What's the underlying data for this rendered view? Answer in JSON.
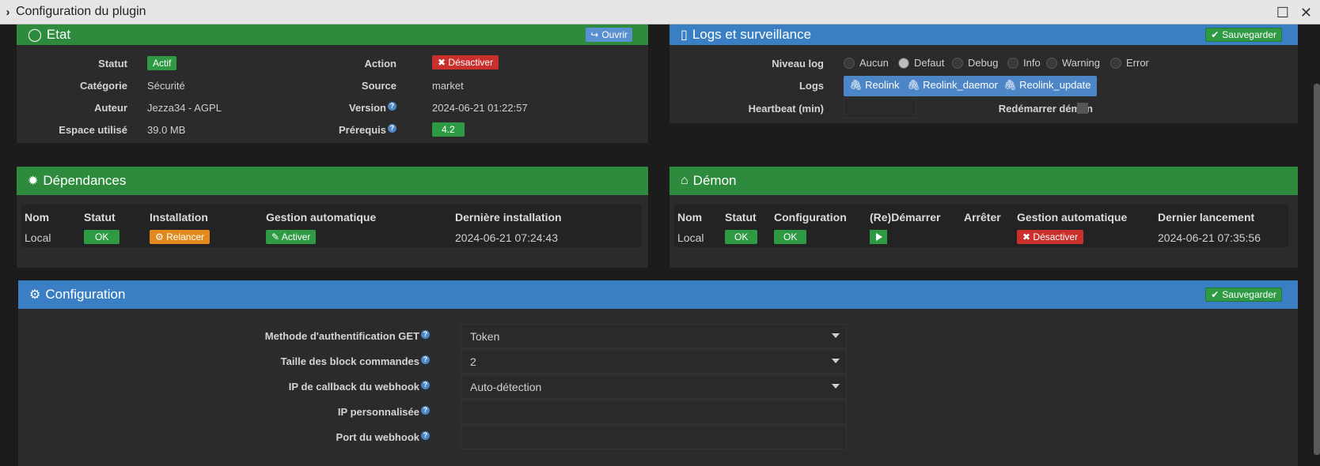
{
  "window": {
    "title": "Configuration du plugin"
  },
  "etat": {
    "title": "Etat",
    "open_button": "Ouvrir",
    "statut_label": "Statut",
    "statut_value": "Actif",
    "categorie_label": "Catégorie",
    "categorie_value": "Sécurité",
    "auteur_label": "Auteur",
    "auteur_value": "Jezza34",
    "auteur_license": " - AGPL",
    "espace_label": "Espace utilisé",
    "espace_value": "39.0 MB",
    "action_label": "Action",
    "action_button": "Désactiver",
    "source_label": "Source",
    "source_value": "market",
    "version_label": "Version",
    "version_value": "2024-06-21 01:22:57",
    "prerequis_label": "Prérequis",
    "prerequis_value": "4.2"
  },
  "logs": {
    "title": "Logs et surveillance",
    "save_button": "Sauvegarder",
    "niveau_label": "Niveau log",
    "levels": [
      "Aucun",
      "Defaut",
      "Debug",
      "Info",
      "Warning",
      "Error"
    ],
    "selected_level": "Defaut",
    "logs_label": "Logs",
    "log_buttons": [
      "Reolink",
      "Reolink_daemon",
      "Reolink_update"
    ],
    "heartbeat_label": "Heartbeat (min)",
    "heartbeat_value": "",
    "restart_label": "Redémarrer démon"
  },
  "dependances": {
    "title": "Dépendances",
    "headers": [
      "Nom",
      "Statut",
      "Installation",
      "Gestion automatique",
      "Dernière installation"
    ],
    "row": {
      "nom": "Local",
      "statut": "OK",
      "installation": "Relancer",
      "gestion": "Activer",
      "derniere": "2024-06-21 07:24:43"
    }
  },
  "demon": {
    "title": "Démon",
    "headers": [
      "Nom",
      "Statut",
      "Configuration",
      "(Re)Démarrer",
      "Arrêter",
      "Gestion automatique",
      "Dernier lancement"
    ],
    "row": {
      "nom": "Local",
      "statut": "OK",
      "configuration": "OK",
      "gestion": "Désactiver",
      "dernier": "2024-06-21 07:35:56"
    }
  },
  "configuration": {
    "title": "Configuration",
    "save_button": "Sauvegarder",
    "fields": [
      {
        "label": "Methode d'authentification GET",
        "value": "Token",
        "type": "select"
      },
      {
        "label": "Taille des block commandes",
        "value": "2",
        "type": "select"
      },
      {
        "label": "IP de callback du webhook",
        "value": "Auto-détection",
        "type": "select"
      },
      {
        "label": "IP personnalisée",
        "value": "",
        "type": "input"
      },
      {
        "label": "Port du webhook",
        "value": "",
        "type": "input"
      }
    ]
  },
  "icons": {
    "help": "?",
    "check": "✔",
    "times": "✖"
  }
}
